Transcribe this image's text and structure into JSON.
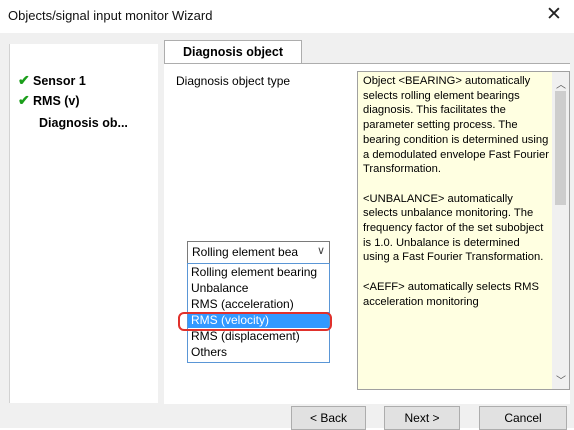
{
  "window": {
    "title": "Objects/signal input monitor Wizard",
    "close_glyph": "✕"
  },
  "steps": [
    {
      "label": "Sensor 1",
      "done": true,
      "icon": "check-icon"
    },
    {
      "label": "RMS (v)",
      "done": true,
      "icon": "check-icon"
    },
    {
      "label": "Diagnosis ob...",
      "done": false,
      "icon": ""
    }
  ],
  "tab": {
    "label": "Diagnosis object"
  },
  "field": {
    "label": "Diagnosis object type"
  },
  "combo": {
    "value": "Rolling element bea",
    "chevron": "∨"
  },
  "dropdown": {
    "options": [
      "Rolling element bearing",
      "Unbalance",
      "RMS (acceleration)",
      "RMS (velocity)",
      "RMS (displacement)",
      "Others"
    ],
    "selected_index": 3
  },
  "help": {
    "text": "Object <BEARING> automatically selects rolling element bearings diagnosis. This facilitates the parameter setting process. The bearing condition is determined using a demodulated envelope Fast Fourier Transformation.\n\n<UNBALANCE> automatically selects unbalance monitoring. The frequency factor of the set subobject is 1.0. Unbalance is determined using a Fast Fourier Transformation.\n\n<AEFF> automatically selects RMS acceleration monitoring"
  },
  "buttons": {
    "back": "< Back",
    "next": "Next >",
    "cancel": "Cancel"
  },
  "colors": {
    "check": "#1a9e1a",
    "selection": "#3399ff",
    "highlight": "#e0312c",
    "help_bg": "#ffffe1"
  }
}
